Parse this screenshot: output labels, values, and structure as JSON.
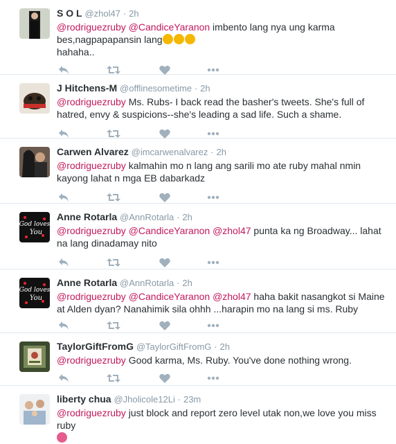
{
  "colors": {
    "mention": "#c2185b",
    "meta": "#8899a6",
    "icon": "#a0b0bc",
    "divider": "#e1e8ed"
  },
  "tweets": [
    {
      "name": "S O L",
      "handle": "@zhol47",
      "time": "2h",
      "avatar": "woman-dark-portrait",
      "mentions": [
        "@rodriguezruby",
        "@CandiceYaranon"
      ],
      "text": " imbento lang nya ung karma bes,nagpapapansin lang",
      "emojis": [
        "sad-face-emoji",
        "sad-face-emoji",
        "sad-face-emoji"
      ],
      "text2": "hahaha.."
    },
    {
      "name": "J Hitchens-M",
      "handle": "@offlinesometime",
      "time": "2h",
      "avatar": "puppy-photo",
      "mentions": [
        "@rodriguezruby"
      ],
      "text": " Ms. Rubs- I back read the basher's tweets. She's full of hatred, envy & suspicions--she's leading a sad life. Such a shame."
    },
    {
      "name": "Carwen Alvarez",
      "handle": "@imcarwenalvarez",
      "time": "2h",
      "avatar": "couple-photo",
      "mentions": [
        "@rodriguezruby"
      ],
      "text": " kalmahin mo n lang ang sarili mo ate ruby mahal nmin kayong lahat n mga EB dabarkadz"
    },
    {
      "name": "Anne Rotarla",
      "handle": "@AnnRotarla",
      "time": "2h",
      "avatar": "god-loves-you-graphic",
      "avatar_text": [
        "God loves",
        "You"
      ],
      "mentions": [
        "@rodriguezruby",
        "@CandiceYaranon",
        "@zhol47"
      ],
      "text": " punta ka ng Broadway... lahat na lang dinadamay nito"
    },
    {
      "name": "Anne Rotarla",
      "handle": "@AnnRotarla",
      "time": "2h",
      "avatar": "god-loves-you-graphic",
      "avatar_text": [
        "God loves",
        "You"
      ],
      "mentions": [
        "@rodriguezruby",
        "@CandiceYaranon",
        "@zhol47"
      ],
      "text": " haha bakit nasangkot si Maine at Alden dyan? Nanahimik sila ohhh ...harapin mo na lang si ms. Ruby"
    },
    {
      "name": "TaylorGiftFromG",
      "handle": "@TaylorGiftFromG",
      "time": "2h",
      "avatar": "gift-shop-photo",
      "mentions": [
        "@rodriguezruby"
      ],
      "text": " Good karma, Ms. Ruby. You've done nothing wrong."
    },
    {
      "name": "liberty chua",
      "handle": "@Jholicole12Li",
      "time": "23m",
      "avatar": "family-photo",
      "mentions": [
        "@rodriguezruby"
      ],
      "text": " just block and report zero level utak non,we love you miss ruby",
      "emojis": [
        "heart-eyes-emoji"
      ]
    }
  ]
}
